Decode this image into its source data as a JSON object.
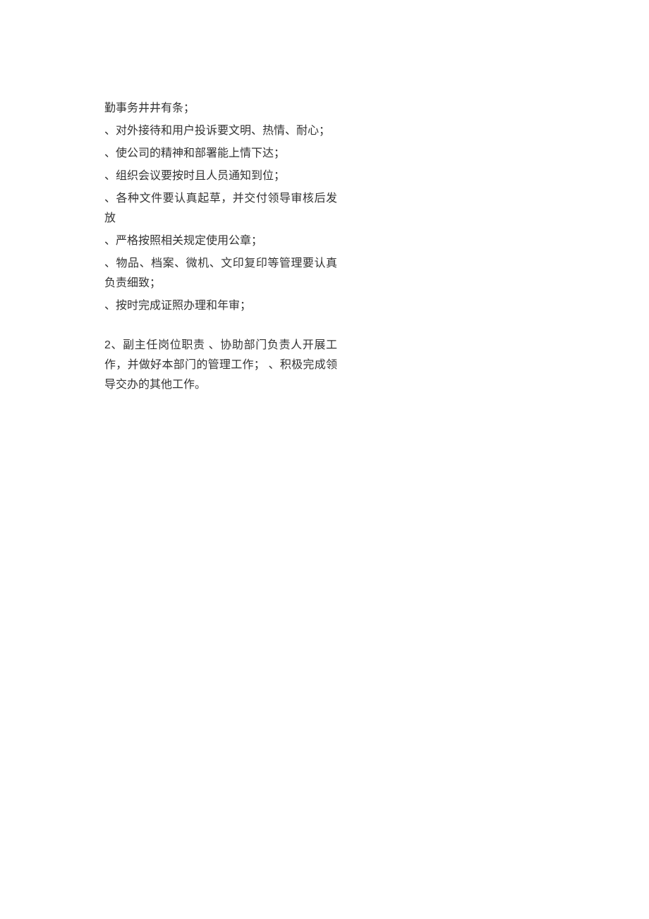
{
  "section1": {
    "line0": "勤事务井井有条；",
    "line1": "、对外接待和用户投诉要文明、热情、耐心；",
    "line2": "、使公司的精神和部署能上情下达；",
    "line3": "、组织会议要按时且人员通知到位；",
    "line4": "、各种文件要认真起草，并交付领导审核后发放",
    "line5": "、严格按照相关规定使用公章；",
    "line6": "、物品、档案、微机、文印复印等管理要认真负责细致；",
    "line7": "、按时完成证照办理和年审；"
  },
  "section2": {
    "num": "2",
    "text": "、副主任岗位职责 、协助部门负责人开展工作，并做好本部门的管理工作； 、积极完成领导交办的其他工作。"
  }
}
